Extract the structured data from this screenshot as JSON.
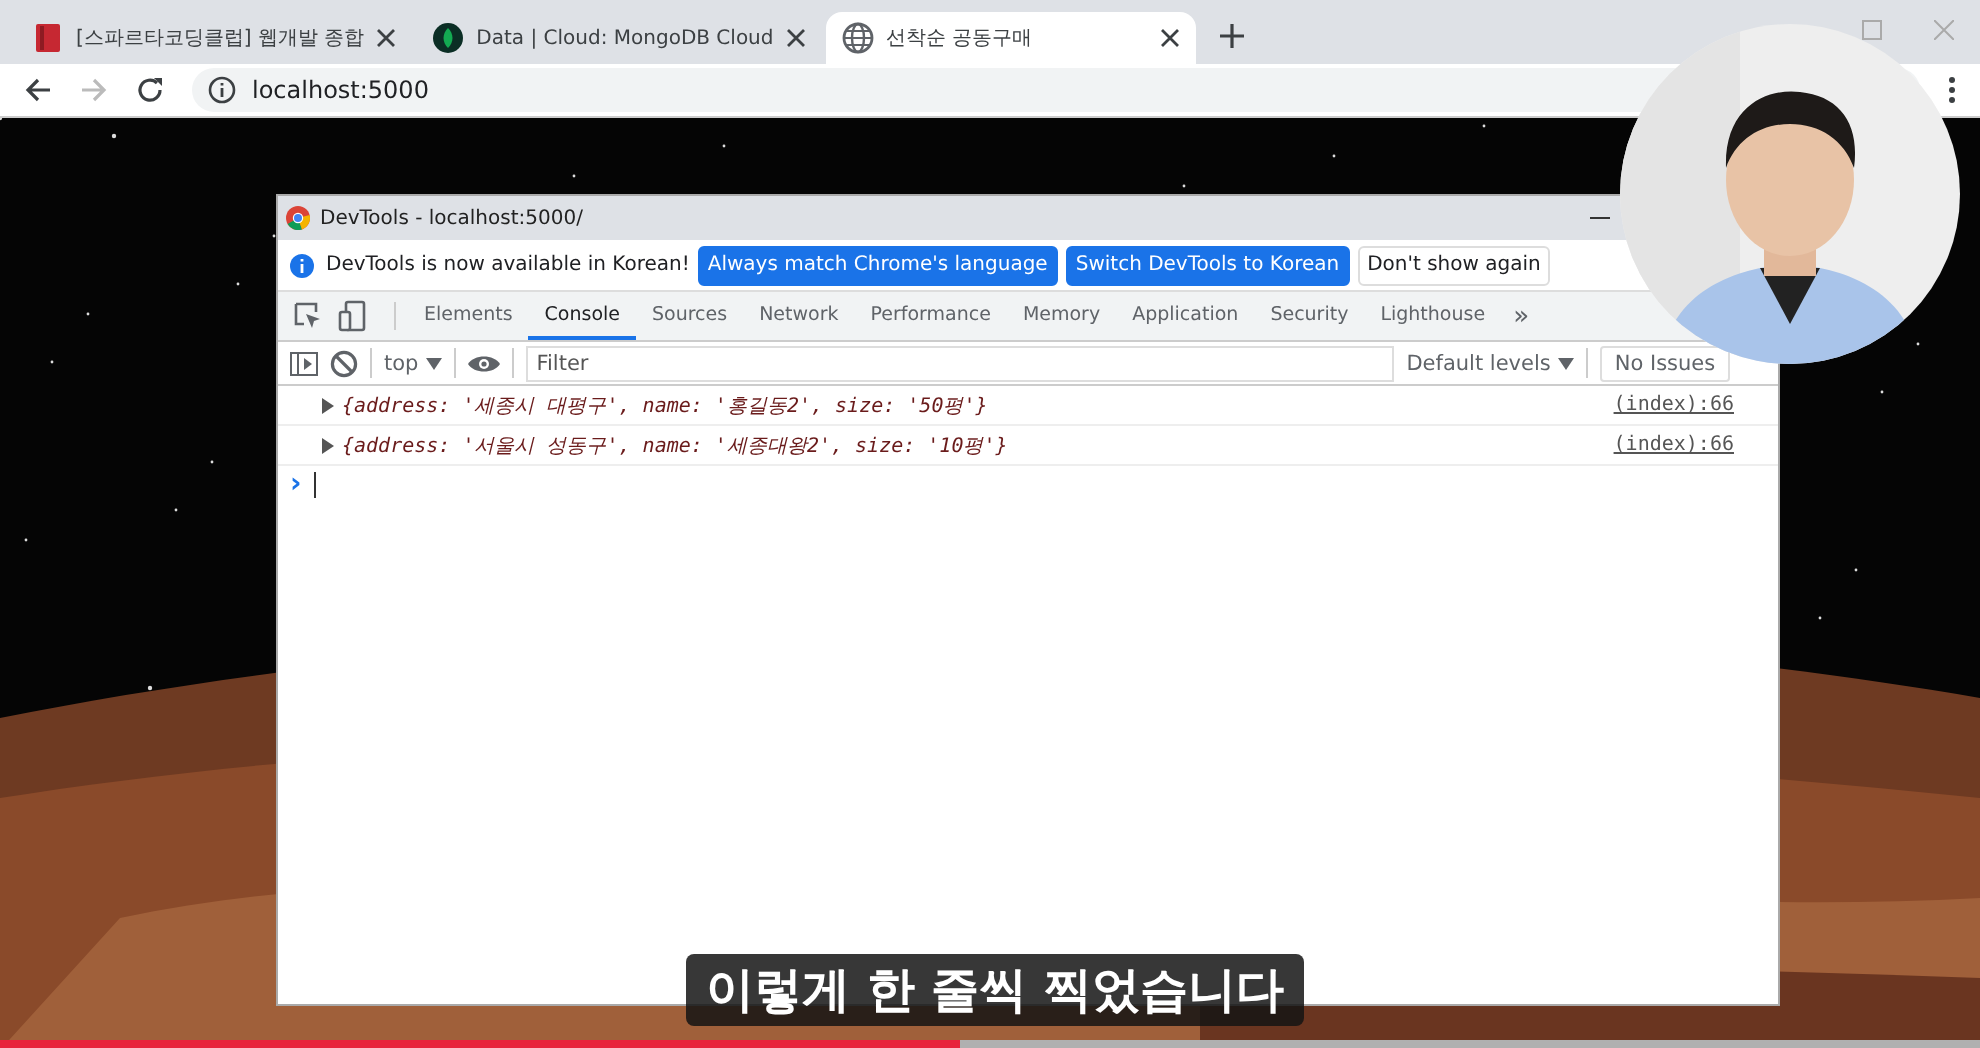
{
  "browser": {
    "tabs": [
      {
        "title": "[스파르타코딩클럽] 웹개발 종합",
        "selected": false
      },
      {
        "title": "Data | Cloud: MongoDB Cloud",
        "selected": false
      },
      {
        "title": "선착순 공동구매",
        "selected": true
      }
    ],
    "address": "localhost:5000"
  },
  "devtools": {
    "title": "DevTools - localhost:5000/",
    "infobar": {
      "message": "DevTools is now available in Korean!",
      "buttons": [
        {
          "label": "Always match Chrome's language",
          "primary": true
        },
        {
          "label": "Switch DevTools to Korean",
          "primary": true
        },
        {
          "label": "Don't show again",
          "primary": false
        }
      ]
    },
    "panels": [
      {
        "label": "Elements",
        "selected": false
      },
      {
        "label": "Console",
        "selected": true
      },
      {
        "label": "Sources",
        "selected": false
      },
      {
        "label": "Network",
        "selected": false
      },
      {
        "label": "Performance",
        "selected": false
      },
      {
        "label": "Memory",
        "selected": false
      },
      {
        "label": "Application",
        "selected": false
      },
      {
        "label": "Security",
        "selected": false
      },
      {
        "label": "Lighthouse",
        "selected": false
      }
    ],
    "more": "»",
    "console_toolbar": {
      "context": "top",
      "filter_placeholder": "Filter",
      "levels": "Default levels",
      "issues": "No Issues"
    },
    "messages": [
      {
        "text": "{address: '세종시 대평구', name: '홍길동2', size: '50평'}",
        "source": "(index):66"
      },
      {
        "text": "{address: '서울시 성동구', name: '세종대왕2', size: '10평'}",
        "source": "(index):66"
      }
    ],
    "prompt": "›"
  },
  "subtitle": "이렇게 한 줄씩 찍었습니다",
  "video_progress": {
    "level": 0.485
  }
}
